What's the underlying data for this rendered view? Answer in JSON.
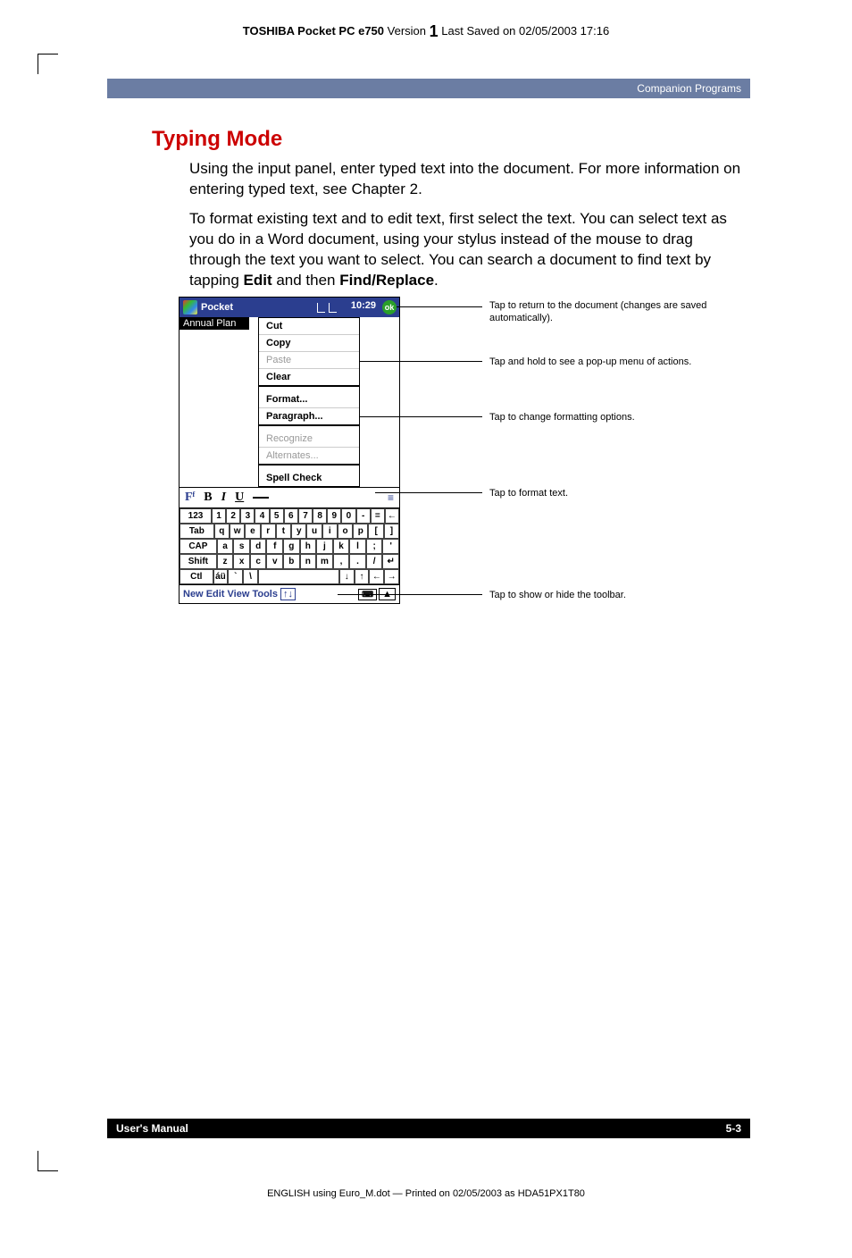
{
  "header": {
    "prefix": "TOSHIBA Pocket PC e750",
    "version_word": "Version",
    "version_num": "1",
    "suffix": "Last Saved on 02/05/2003 17:16"
  },
  "chapter_bar": "Companion Programs",
  "heading": "Typing Mode",
  "paragraphs": {
    "p1": "Using the input panel, enter typed text into the document. For more information on entering typed text, see Chapter 2.",
    "p2a": "To format existing text and to edit text, first select the text. You can select text as you do in a Word document, using your stylus instead of the mouse to drag through the text you want to select. You can search a document to find text by tapping ",
    "p2b": "Edit",
    "p2c": " and then ",
    "p2d": "Find/Replace",
    "p2e": "."
  },
  "screenshot": {
    "title": "Pocket",
    "time": "10:29",
    "ok": "ok",
    "filename": "Annual Plan",
    "menu": {
      "cut": "Cut",
      "copy": "Copy",
      "paste": "Paste",
      "clear": "Clear",
      "format": "Format...",
      "paragraph": "Paragraph...",
      "recognize": "Recognize",
      "alternates": "Alternates...",
      "spell": "Spell Check"
    },
    "toolbar": {
      "ff": "Fᶠ",
      "b": "B",
      "i": "I",
      "u": "U",
      "bullets": "≡"
    },
    "sip_rows": [
      [
        "123",
        "1",
        "2",
        "3",
        "4",
        "5",
        "6",
        "7",
        "8",
        "9",
        "0",
        "-",
        "=",
        "←"
      ],
      [
        "Tab",
        "q",
        "w",
        "e",
        "r",
        "t",
        "y",
        "u",
        "i",
        "o",
        "p",
        "[",
        "]"
      ],
      [
        "CAP",
        "a",
        "s",
        "d",
        "f",
        "g",
        "h",
        "j",
        "k",
        "l",
        ";",
        "'"
      ],
      [
        "Shift",
        "z",
        "x",
        "c",
        "v",
        "b",
        "n",
        "m",
        ",",
        ".",
        "/",
        "↵"
      ],
      [
        "Ctl",
        "áü",
        "`",
        "\\",
        " ",
        "↓",
        "↑",
        "←",
        "→"
      ]
    ],
    "bottombar": {
      "new_": "New",
      "edit": "Edit",
      "view": "View",
      "tools": "Tools",
      "arrows": "↑↓",
      "kb": "⌨",
      "tri": "▲"
    }
  },
  "callouts": {
    "c1": "Tap to return to the document (changes are saved automatically).",
    "c2": "Tap and hold to see a pop-up menu of actions.",
    "c3": "Tap to change formatting options.",
    "c4": "Tap to format text.",
    "c5": "Tap to show or hide the toolbar."
  },
  "footer": {
    "left": "User's Manual",
    "right": "5-3",
    "print": "ENGLISH using Euro_M.dot — Printed on 02/05/2003 as HDA51PX1T80"
  }
}
